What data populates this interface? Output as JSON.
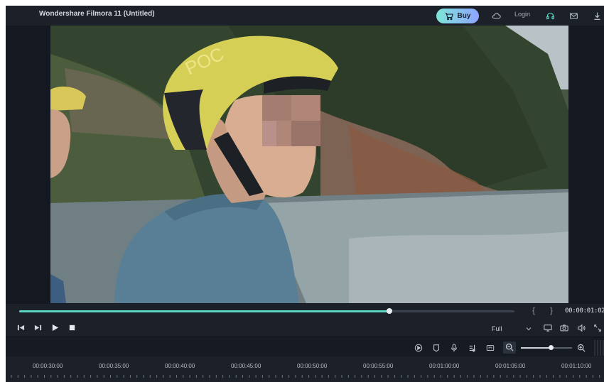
{
  "app": {
    "title": "Wondershare Filmora 11 (Untitled)"
  },
  "header": {
    "buy_label": "Buy",
    "login_label": "Login",
    "icons": [
      "shopping-cart-icon",
      "cloud-icon",
      "headset-support-icon",
      "mail-icon",
      "download-icon"
    ]
  },
  "preview": {
    "progress": 0.748,
    "timecode": "00:00:01:02",
    "mark_in": "{",
    "mark_out": "}"
  },
  "controls": {
    "quality": "Full",
    "icons": [
      "step-back-icon",
      "step-forward-icon",
      "play-icon",
      "stop-icon",
      "monitor-icon",
      "snapshot-icon",
      "volume-icon",
      "fullscreen-icon"
    ]
  },
  "timeline_toolbar": {
    "icons": [
      "render-icon",
      "marker-icon",
      "voiceover-mic-icon",
      "audio-mixer-icon",
      "subtitle-icon",
      "zoom-out-icon",
      "zoom-in-icon"
    ],
    "zoom_level": 0.58
  },
  "ruler": {
    "labels": [
      "00:00:30:00",
      "00:00:35:00",
      "00:00:40:00",
      "00:00:45:00",
      "00:00:50:00",
      "00:00:55:00",
      "00:01:00:00",
      "00:01:05:00",
      "00:01:10:00"
    ]
  },
  "colors": {
    "accent": "#58d6c1",
    "buy_gradient_start": "#7fe6d7",
    "buy_gradient_end": "#8fa4ff",
    "panel": "#1c2029"
  }
}
